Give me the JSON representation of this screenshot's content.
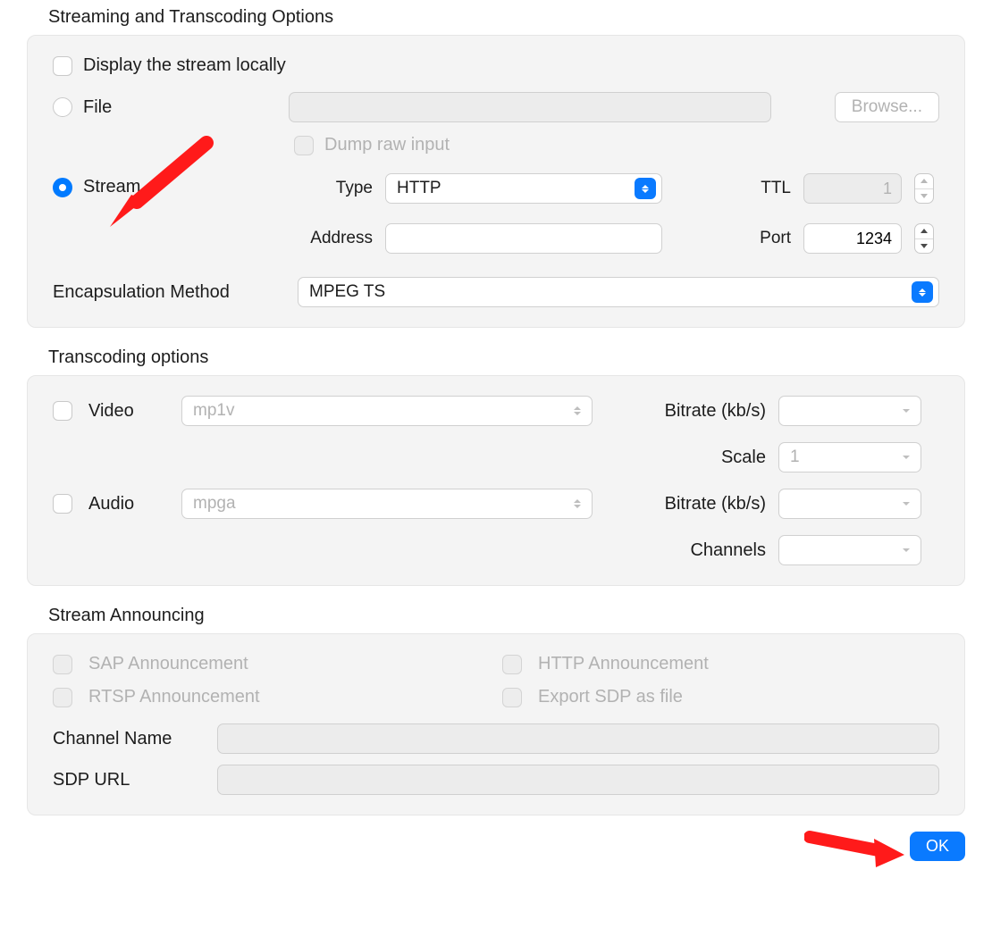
{
  "section1": {
    "title": "Streaming and Transcoding Options",
    "display_locally_label": "Display the stream locally",
    "file_label": "File",
    "browse_label": "Browse...",
    "dump_raw_label": "Dump raw input",
    "stream_label": "Stream",
    "type_label": "Type",
    "type_value": "HTTP",
    "ttl_label": "TTL",
    "ttl_value": "1",
    "address_label": "Address",
    "address_value": "",
    "port_label": "Port",
    "port_value": "1234",
    "encaps_label": "Encapsulation Method",
    "encaps_value": "MPEG TS"
  },
  "section2": {
    "title": "Transcoding options",
    "video_label": "Video",
    "video_codec": "mp1v",
    "video_bitrate_label": "Bitrate (kb/s)",
    "video_bitrate_value": "",
    "scale_label": "Scale",
    "scale_value": "1",
    "audio_label": "Audio",
    "audio_codec": "mpga",
    "audio_bitrate_label": "Bitrate (kb/s)",
    "audio_bitrate_value": "",
    "channels_label": "Channels",
    "channels_value": ""
  },
  "section3": {
    "title": "Stream Announcing",
    "sap_label": "SAP Announcement",
    "http_label": "HTTP Announcement",
    "rtsp_label": "RTSP Announcement",
    "export_sdp_label": "Export SDP as file",
    "channel_name_label": "Channel Name",
    "channel_name_value": "",
    "sdp_url_label": "SDP URL",
    "sdp_url_value": ""
  },
  "footer": {
    "ok_label": "OK"
  }
}
